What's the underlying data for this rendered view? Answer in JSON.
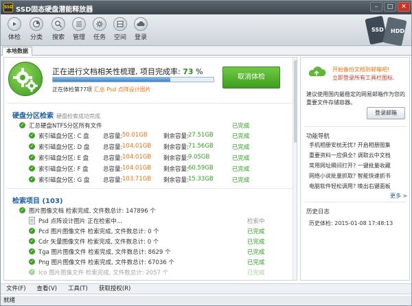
{
  "window": {
    "title": "SSD固态硬盘潜能释放器",
    "app_badge": "SSD"
  },
  "toolbar": {
    "items": [
      {
        "label": "体检",
        "icon": "play-icon"
      },
      {
        "label": "分类",
        "icon": "pie-icon"
      },
      {
        "label": "搜索",
        "icon": "search-icon"
      },
      {
        "label": "管理",
        "icon": "list-icon"
      },
      {
        "label": "任务",
        "icon": "gear-icon"
      },
      {
        "label": "空间",
        "icon": "storage-icon"
      },
      {
        "label": "登录",
        "icon": "cloud-icon"
      }
    ],
    "ssd_badge": {
      "line1": "SSD",
      "line2": "HDD"
    }
  },
  "tabs": [
    {
      "label": "本地数据"
    }
  ],
  "status": {
    "title_prefix": "正在进行文档相关性梳理, 项目完成率:",
    "percent_text": "73",
    "percent_unit": "%",
    "progress": 0.73,
    "sub_prefix": "正在体检第77项",
    "sub_highlight": "汇总 Psd 点阵设计图片",
    "cancel_button": "取消体检"
  },
  "partitions": {
    "heading": "硬盘分区检索",
    "sub": "硬盘检索成功完成",
    "summary_label": "汇总硬盘NTFS分区所有文件",
    "summary_status": "已完成",
    "rows": [
      {
        "name": "索引磁盘分区: C 盘",
        "total_label": "总容量:",
        "total": "50.01GB",
        "free_label": "剩余容量:",
        "free": "27.51GB",
        "status": "已完成"
      },
      {
        "name": "索引磁盘分区: D 盘",
        "total_label": "总容量:",
        "total": "104.01GB",
        "free_label": "剩余容量:",
        "free": "71.56GB",
        "status": "已完成"
      },
      {
        "name": "索引磁盘分区: E 盘",
        "total_label": "总容量:",
        "total": "104.01GB",
        "free_label": "剩余容量:",
        "free": "9.05GB",
        "status": "已完成"
      },
      {
        "name": "索引磁盘分区: F 盘",
        "total_label": "总容量:",
        "total": "104.01GB",
        "free_label": "剩余容量:",
        "free": "60.59GB",
        "status": "已完成"
      },
      {
        "name": "索引磁盘分区: G 盘",
        "total_label": "总容量:",
        "total": "103.71GB",
        "free_label": "剩余容量:",
        "free": "15.33GB",
        "status": "已完成"
      }
    ]
  },
  "search": {
    "heading": "检索项目 (103)",
    "items": [
      {
        "text": "图片图像文档 检索完成, 文件数总计: 147896 个",
        "status": "",
        "kind": "folder"
      },
      {
        "text": "Psd 点阵设计图片 正在检索中...",
        "status": "检索中",
        "kind": "active"
      },
      {
        "text": "Pcd 图片图像文件 检索完成, 文件数总计: 0 个",
        "status": "已完成",
        "kind": "done"
      },
      {
        "text": "Cdr 矢量图像文件 检索完成, 文件数总计: 0 个",
        "status": "已完成",
        "kind": "done"
      },
      {
        "text": "Tga 图片图像文件 检索完成, 文件数总计: 8629 个",
        "status": "已完成",
        "kind": "done"
      },
      {
        "text": "Png 图片图像文件 检索完成, 文件数总计: 67036 个",
        "status": "已完成",
        "kind": "done"
      },
      {
        "text": "Ico 图片图像文件 检索完成, 文件数总计: 2057 个",
        "status": "已完成",
        "kind": "faded"
      }
    ]
  },
  "right": {
    "promo_line1": "开始备份文档到邮箱吧!",
    "promo_line2": "立即登录所有工具栏图标.",
    "promo_desc": "建议使用国内最稳定的网易邮箱作为您的重要文件存储容器。",
    "login_button": "登录邮箱",
    "nav_heading": "功能导航",
    "nav_items": [
      "手机相册安枕无忧? 开启相册图集",
      "重要资料一应俱全? 调取云中文档",
      "常用网址瞬间打开? 一键批量收藏",
      "网络小说批量抓取? 智能快速抓书",
      "电脑软件轻松调用? 唤出右键面板"
    ],
    "more": "更多 >",
    "history_heading": "历史日志",
    "history_text": "历史体检: 2015-01-08 17:48:13"
  },
  "menubar": [
    "文件(F)",
    "查看(V)",
    "工具(T)",
    "获取授权(R)"
  ],
  "statusbar": "就绪"
}
